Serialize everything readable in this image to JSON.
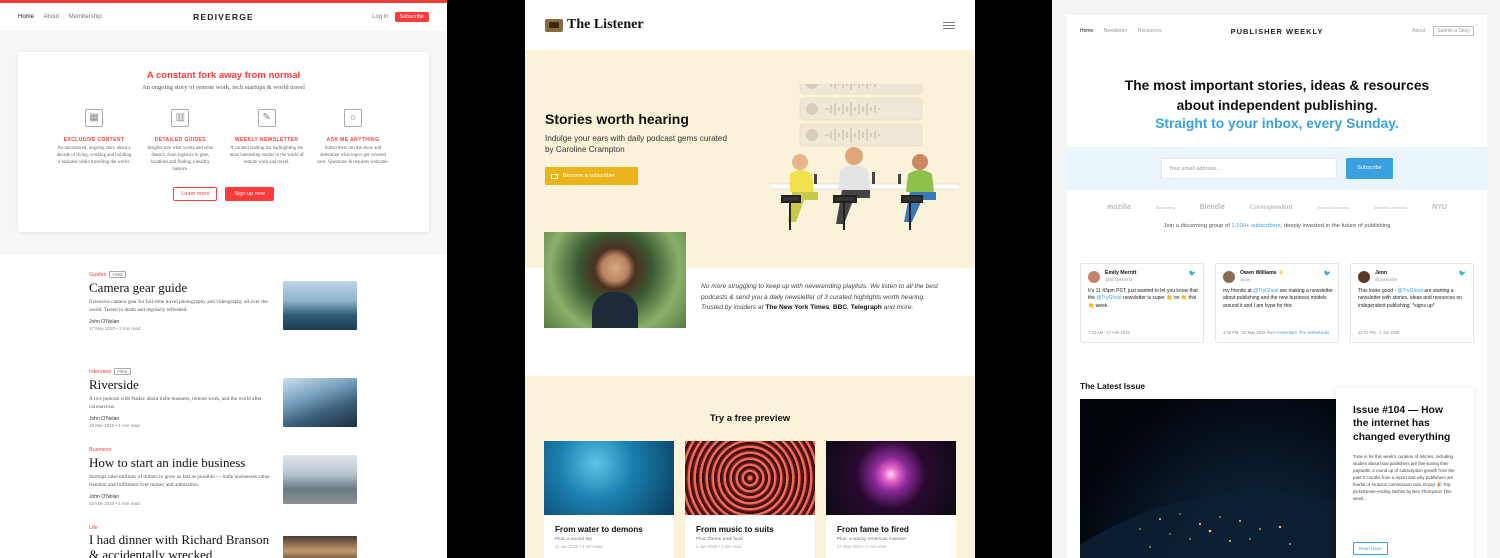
{
  "rediverge": {
    "nav": {
      "home": "Home",
      "about": "About",
      "membership": "Membership",
      "brand": "REDIVERGE",
      "login": "Log in",
      "subscribe": "Subscribe"
    },
    "hero": {
      "title": "A constant fork away from normal",
      "subtitle": "An ongoing story of remote work, tech startups & world travel",
      "features": [
        {
          "icon": "map-icon",
          "heading": "EXCLUSIVE CONTENT",
          "text": "An uncensored, ongoing story about a decade of living, working and building a business while travelling the world."
        },
        {
          "icon": "books-icon",
          "heading": "DETAILED GUIDES",
          "text": "Insights into what works and what doesn't, from logistics to gear, locations and finding a healthy balance."
        },
        {
          "icon": "newsletter-icon",
          "heading": "WEEKLY NEWSLETTER",
          "text": "A curated reading list highlighting the most interesting stories in the world of remote work and travel."
        },
        {
          "icon": "lamp-icon",
          "heading": "ASK ME ANYTHING",
          "text": "Subscribers run the show and determine what topics get covered next. Questions & requests welcome."
        }
      ],
      "learn_more": "Learn more",
      "sign_up": "Sign up now"
    },
    "posts": [
      {
        "category": "Guides",
        "badge": "FREE",
        "title": "Camera gear guide",
        "excerpt": "Extensive camera gear for full-time travel photography and videography all over the world. Tested to death and regularly refreshed.",
        "author": "John O'Nolan",
        "meta": "17 May 2020 • 3 min read"
      },
      {
        "category": "Interview",
        "badge": "FREE",
        "title": "Riverside",
        "excerpt": "A live podcast with Nadav about indie business, remote work, and the world after coronavirus.",
        "author": "John O'Nolan",
        "meta": "18 Mar 2020 • 1 min read"
      },
      {
        "category": "Business",
        "badge": "",
        "title": "How to start an indie business",
        "excerpt": "Startups raise millions of dollars to grow as fast as possible — indie businesses value freedom and fulfilment over money and admiration.",
        "author": "John O'Nolan",
        "meta": "15 Mar 2020 • 1 min read"
      },
      {
        "category": "Life",
        "badge": "",
        "title": "I had dinner with Richard Branson & accidentally wrecked",
        "excerpt": "",
        "author": "",
        "meta": ""
      }
    ]
  },
  "listener": {
    "logo": "The Listener",
    "hero": {
      "title": "Stories worth hearing",
      "subtitle": "Indulge your ears with daily podcast gems curated by Caroline Crampton",
      "cta": "Become a subscriber"
    },
    "intro": {
      "text_1": "No more struggling to keep up with neverending playlists. We listen to all the best podcasts & send you a daily newsletter of 3 curated highlights worth hearing. Trusted by insiders at ",
      "pub_1": "The New York Times",
      "sep_1": ", ",
      "pub_2": "BBC",
      "sep_2": ", ",
      "pub_3": "Telegraph",
      "text_2": " and more."
    },
    "preview": {
      "title": "Try a free preview",
      "cards": [
        {
          "title": "From water to demons",
          "plus": "Plus: a sound trip",
          "meta": "11 Jun 2020 • 1 min read"
        },
        {
          "title": "From music to suits",
          "plus": "Plus: theme park food",
          "meta": "3 Jun 2020 • 1 min read"
        },
        {
          "title": "From fame to fired",
          "plus": "Plus: a wacky American inventor",
          "meta": "27 May 2020 • 1 min read"
        }
      ]
    }
  },
  "publisher": {
    "nav": {
      "home": "Home",
      "newsletter": "Newsletter",
      "resources": "Resources",
      "brand": "PUBLISHER WEEKLY",
      "about": "About",
      "submit": "Submit a Story"
    },
    "headline_1": "The most important stories, ideas & resources",
    "headline_2": "about independent publishing.",
    "headline_3": "Straight to your inbox, every Sunday.",
    "signup": {
      "placeholder": "Your email address...",
      "button": "Subscribe"
    },
    "logos": [
      "mozilla",
      "Bloomberg",
      "Blendle",
      "Correspondent",
      "Harvard Business",
      "Stanford University",
      "NYU"
    ],
    "join_prefix": "Join a discerning group of ",
    "join_count": "1,100+ subscribers",
    "join_suffix": ", deeply invested in the future of publishing",
    "tweets": [
      {
        "name": "Emily Merritt",
        "handle": "@EmilyMerritt",
        "text_1": "It's 11:43pm PST, just wanted to let you know that the ",
        "mention": "@TryGhost",
        "text_2": " newsletter is super 👏 on 👏 this 👏 week.",
        "time": "7:43 AM - 17 Feb 2019",
        "time_link": ""
      },
      {
        "name": "Owen Williams ⚡",
        "handle": "@ow",
        "text_1": "my friends at ",
        "mention": "@TryGhost",
        "text_2": " are making a newsletter about publishing and the new business models around it and I am hype for this",
        "time": "4:36 PM - 30 May 2018 from ",
        "time_link": "Amsterdam, The Netherlands"
      },
      {
        "name": "Jenn",
        "handle": "@Jyinnyihe",
        "text_1": "This looks good - ",
        "mention": "@TryGhost",
        "text_2": " are starting a newsletter with stories, ideas and resources on independent publishing. *signs up*",
        "time": "12:01 PM - 2 Jun 2018",
        "time_link": ""
      }
    ],
    "latest": {
      "label": "The Latest Issue",
      "title": "Issue #104 — How the internet has changed everything",
      "desc": "Tune in for this week's curation of articles, including studies about how publishers are fine-tuning their paywalls, a round up of subscription growth from the past 3 months from a report and why publishers are fearful of Amazon commission cuts. Enjoy! 🎉 Top picks!Never-ending Niches by Ben Thompson This week...",
      "read": "Read Issue"
    }
  }
}
